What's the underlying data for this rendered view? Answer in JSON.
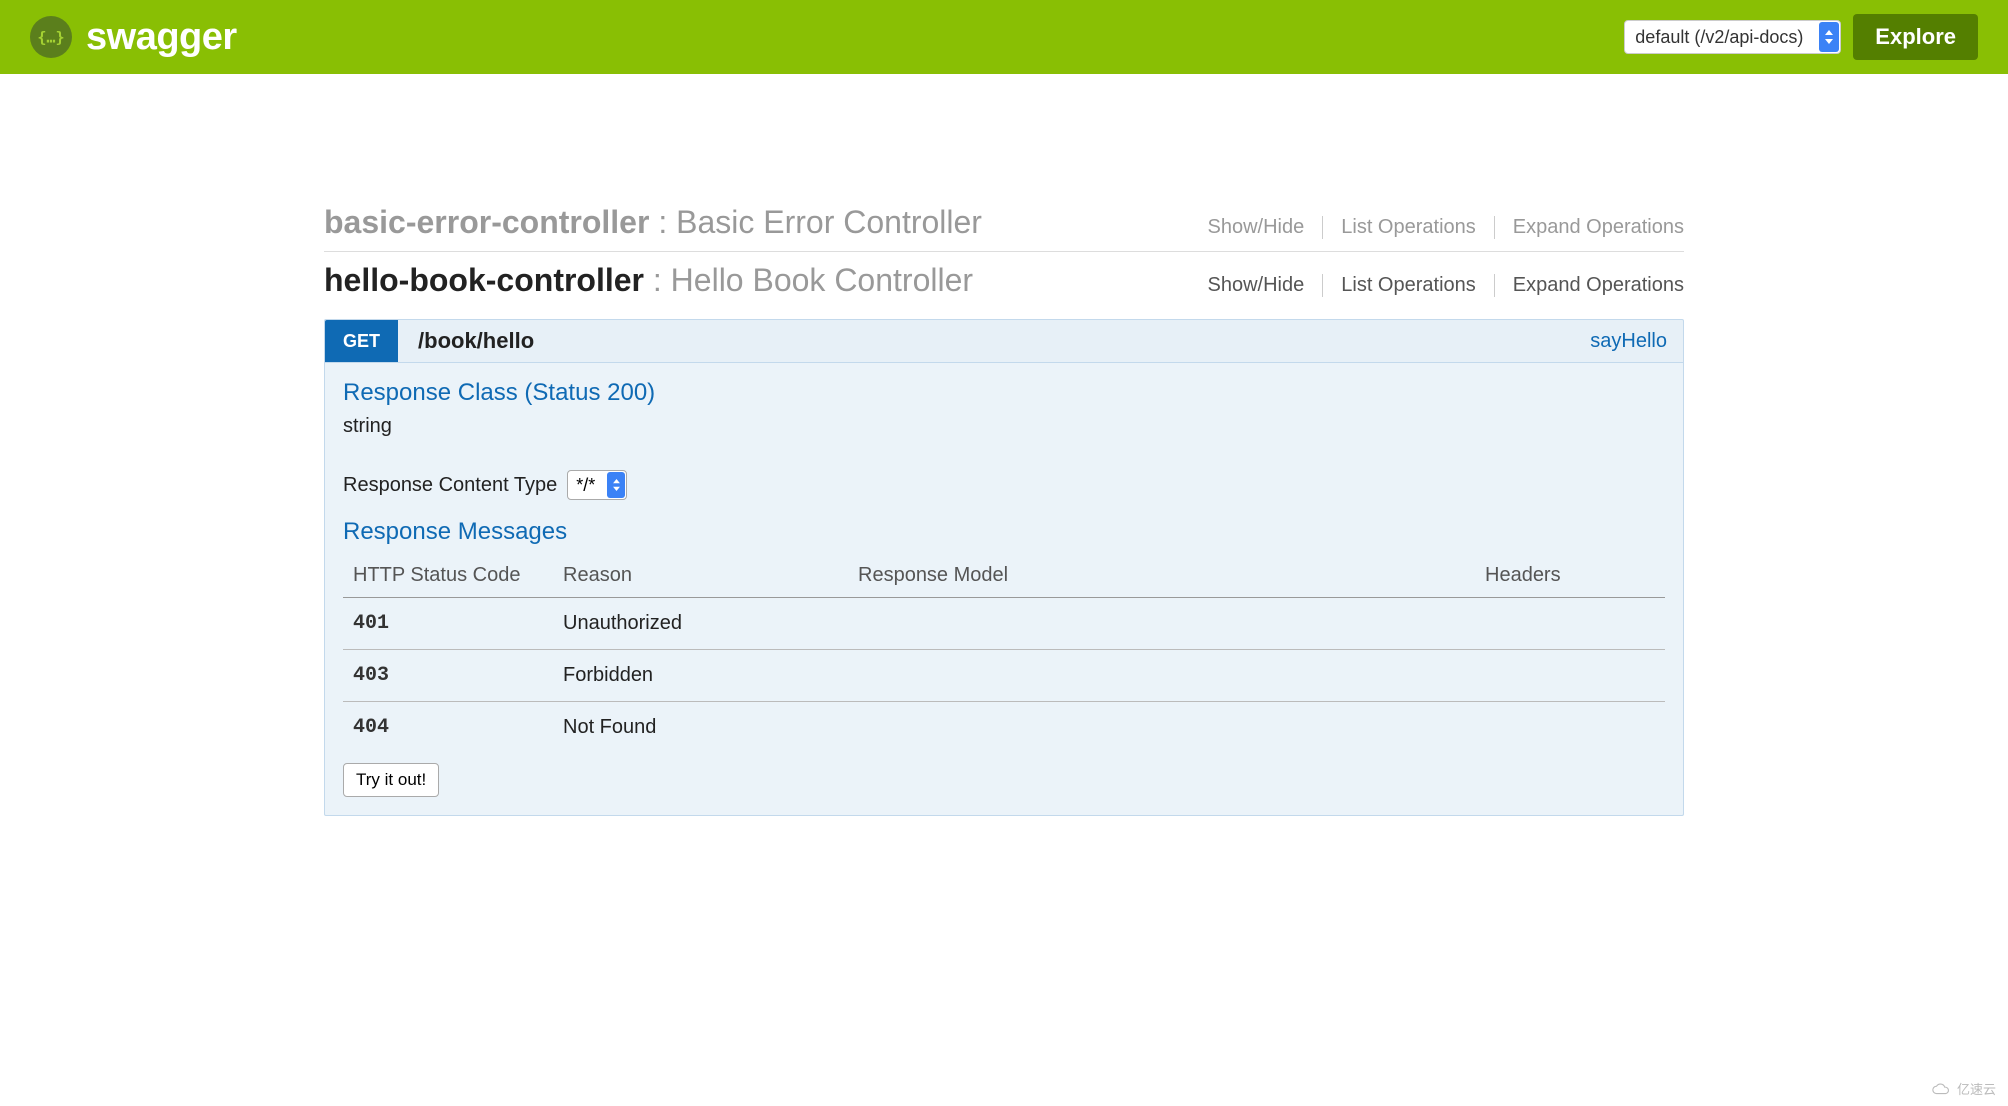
{
  "header": {
    "brand": "swagger",
    "api_select": "default (/v2/api-docs)",
    "explore_label": "Explore"
  },
  "controllers": [
    {
      "name": "basic-error-controller",
      "desc": "Basic Error Controller",
      "active": false,
      "actions": {
        "showhide": "Show/Hide",
        "listops": "List Operations",
        "expandops": "Expand Operations"
      }
    },
    {
      "name": "hello-book-controller",
      "desc": "Hello Book Controller",
      "active": true,
      "actions": {
        "showhide": "Show/Hide",
        "listops": "List Operations",
        "expandops": "Expand Operations"
      }
    }
  ],
  "operation": {
    "method": "GET",
    "path": "/book/hello",
    "nickname": "sayHello",
    "response_class_title": "Response Class (Status 200)",
    "response_type": "string",
    "content_type_label": "Response Content Type",
    "content_type_value": "*/*",
    "response_messages_title": "Response Messages",
    "table_headers": {
      "code": "HTTP Status Code",
      "reason": "Reason",
      "model": "Response Model",
      "headers": "Headers"
    },
    "messages": [
      {
        "code": "401",
        "reason": "Unauthorized"
      },
      {
        "code": "403",
        "reason": "Forbidden"
      },
      {
        "code": "404",
        "reason": "Not Found"
      }
    ],
    "try_label": "Try it out!"
  },
  "watermark": "亿速云"
}
